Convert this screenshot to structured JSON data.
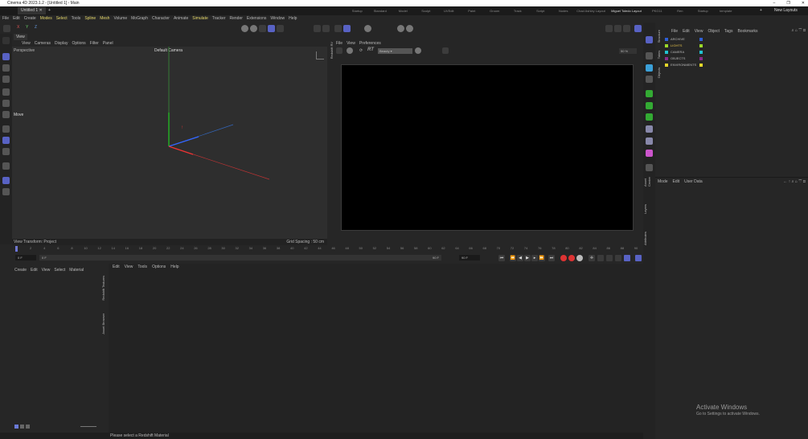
{
  "title": "Cinema 4D 2023.1.2 - [Untitled 1] - Main",
  "doc_tab": "Untitled 1",
  "layouts": [
    "Startup",
    "Standard",
    "Model",
    "Sculpt",
    "UVEdit",
    "Paint",
    "Groom",
    "Track",
    "Script",
    "Nodes",
    "Chad Ashley Layout",
    "Miguel Toledo Layout",
    "PKG11",
    "Ren",
    "Startup",
    "template"
  ],
  "new_layouts": "New Layouts",
  "menu": [
    "File",
    "Edit",
    "Create",
    "Modes",
    "Select",
    "Tools",
    "Spline",
    "Mesh",
    "Volume",
    "MoGraph",
    "Character",
    "Animate",
    "Simulate",
    "Tracker",
    "Render",
    "Extensions",
    "Window",
    "Help"
  ],
  "axes": [
    "X",
    "Y",
    "Z"
  ],
  "viewport": {
    "tab": "View",
    "menu": [
      "View",
      "Cameras",
      "Display",
      "Options",
      "Filter",
      "Panel"
    ],
    "projection": "Perspective",
    "camera": "Default Camera",
    "tool": "Move",
    "view_transform": "View Transform: Project",
    "grid_spacing": "Grid Spacing : 50 cm"
  },
  "redshift": {
    "side_label": "Redshift RV",
    "menu": [
      "File",
      "View",
      "Preferences"
    ],
    "aov": "Beauty",
    "rt": "RT",
    "zoom": "50 %"
  },
  "objects": {
    "menu": [
      "File",
      "Edit",
      "View",
      "Object",
      "Tags",
      "Bookmarks"
    ],
    "tabs": [
      "Objects",
      "Takes",
      "Structure"
    ],
    "items": [
      {
        "name": "ARCHIVE",
        "color": "#2e5fd6"
      },
      {
        "name": "LIGHTS",
        "color": "#9bd82a"
      },
      {
        "name": "CAMERA",
        "color": "#21c2d0"
      },
      {
        "name": "OBJECTS",
        "color": "#8a2a8a"
      },
      {
        "name": "ENVIRONMENTS",
        "color": "#e3d72a"
      }
    ]
  },
  "attributes": {
    "menu": [
      "Mode",
      "Edit",
      "User Data"
    ],
    "tabs": [
      "Attributes",
      "Layers",
      "Asset Center"
    ]
  },
  "timeline": {
    "ticks": [
      "0",
      "2",
      "4",
      "6",
      "8",
      "10",
      "12",
      "14",
      "16",
      "18",
      "20",
      "22",
      "24",
      "26",
      "28",
      "30",
      "32",
      "34",
      "36",
      "38",
      "40",
      "42",
      "44",
      "46",
      "48",
      "50",
      "52",
      "54",
      "56",
      "58",
      "60",
      "62",
      "64",
      "66",
      "68",
      "70",
      "72",
      "74",
      "76",
      "78",
      "80",
      "82",
      "84",
      "86",
      "88",
      "90"
    ],
    "start": "0 F",
    "current": "0 F",
    "end": "90 F",
    "end2": "90 F"
  },
  "material_manager": {
    "menu": [
      "Create",
      "Edit",
      "View",
      "Select",
      "Material"
    ],
    "side_tabs": [
      "Asset Browser",
      "Redshift Textures"
    ]
  },
  "node_editor": {
    "menu": [
      "Edit",
      "View",
      "Tools",
      "Options",
      "Help"
    ]
  },
  "status": "Please select a Redshift Material",
  "watermark": {
    "title": "Activate Windows",
    "subtitle": "Go to Settings to activate Windows."
  }
}
